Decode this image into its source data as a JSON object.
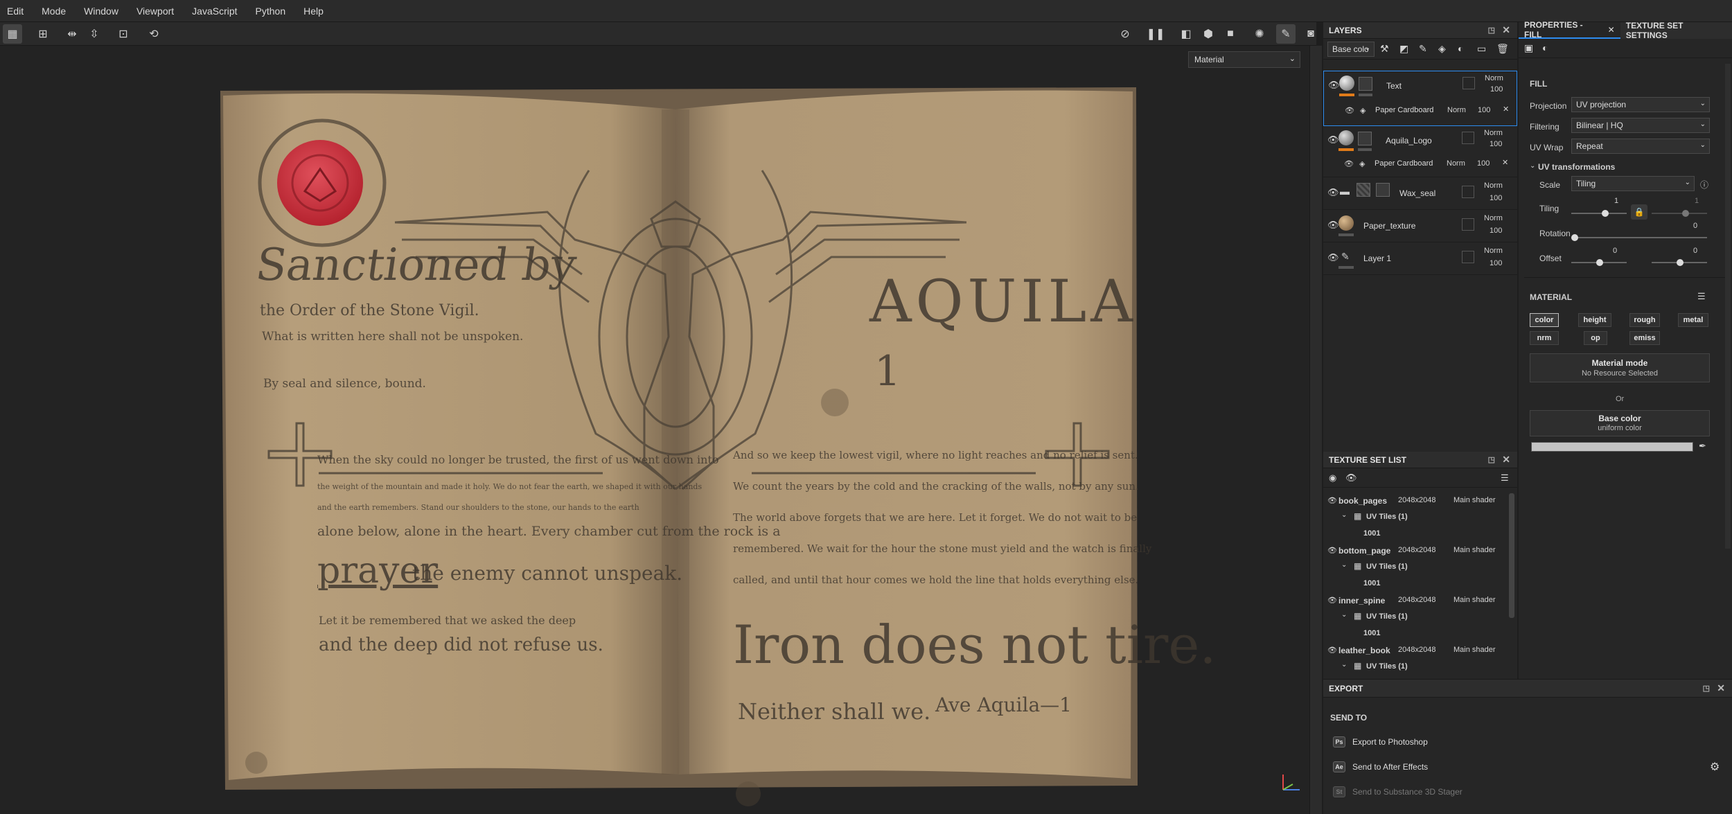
{
  "menu": [
    "Edit",
    "Mode",
    "Window",
    "Viewport",
    "JavaScript",
    "Python",
    "Help"
  ],
  "viewport": {
    "material_select": "Material"
  },
  "book": {
    "left_page": {
      "heading": "Sanctioned by",
      "line1": "the Order of the Stone Vigil.",
      "line2": "What is written here shall not be unspoken.",
      "line3": "By seal and silence, bound.",
      "para1": "When the sky could no longer be trusted, the first of us went down into",
      "para2": "the weight of the mountain and made it holy. We do not fear the earth, we shaped it with our hands",
      "para3": "and the earth remembers. Stand our shoulders to the stone, our hands to the earth",
      "para4": "alone below, alone in the heart. Every chamber cut from the rock is a",
      "prayer": "prayer",
      "prayer_rest": "the enemy cannot unspeak.",
      "remember": "Let it be remembered that we asked the deep",
      "deep": "and the deep did not refuse us."
    },
    "right_page": {
      "title": "AQUILA",
      "number": "1",
      "para1": "And so we keep the lowest vigil, where no light reaches and no relief is sent.",
      "para2": "We count the years by the cold and the cracking of the walls, not by any sun.",
      "para3": "The world above forgets that we are here. Let it forget. We do not wait to be",
      "para4": "remembered. We wait for the hour the stone must yield and the watch is finally",
      "para5": "called, and until that hour comes we hold the line that holds everything else.",
      "iron": "Iron does not tire.",
      "neither": "Neither shall we.",
      "signature": "Ave Aquila—1"
    }
  },
  "layers": {
    "title": "LAYERS",
    "channel": "Base colo",
    "items": [
      {
        "name": "Text",
        "blend": "Norm",
        "opacity": "100",
        "effect": "Paper Cardboard",
        "effect_blend": "Norm",
        "effect_opacity": "100"
      },
      {
        "name": "Aquila_Logo",
        "blend": "Norm",
        "opacity": "100",
        "effect": "Paper Cardboard",
        "effect_blend": "Norm",
        "effect_opacity": "100"
      },
      {
        "name": "Wax_seal",
        "blend": "Norm",
        "opacity": "100"
      },
      {
        "name": "Paper_texture",
        "blend": "Norm",
        "opacity": "100"
      },
      {
        "name": "Layer 1",
        "blend": "Norm",
        "opacity": "100"
      }
    ]
  },
  "texture_sets": {
    "title": "TEXTURE SET LIST",
    "items": [
      {
        "name": "book_pages",
        "res": "2048x2048",
        "shader": "Main shader",
        "uv": "UV Tiles (1)",
        "tile": "1001"
      },
      {
        "name": "bottom_page",
        "res": "2048x2048",
        "shader": "Main shader",
        "uv": "UV Tiles (1)",
        "tile": "1001"
      },
      {
        "name": "inner_spine",
        "res": "2048x2048",
        "shader": "Main shader",
        "uv": "UV Tiles (1)",
        "tile": "1001"
      },
      {
        "name": "leather_book",
        "res": "2048x2048",
        "shader": "Main shader",
        "uv": "UV Tiles (1)"
      }
    ]
  },
  "properties": {
    "tab1": "PROPERTIES - FILL",
    "tab2": "TEXTURE SET SETTINGS",
    "section": "FILL",
    "projection_label": "Projection",
    "projection": "UV projection",
    "filtering_label": "Filtering",
    "filtering": "Bilinear | HQ",
    "uvwrap_label": "UV Wrap",
    "uvwrap": "Repeat",
    "uvt": "UV transformations",
    "scale_label": "Scale",
    "scale": "Tiling",
    "tiling_label": "Tiling",
    "tiling_value": "1",
    "tiling_value2": "1",
    "rotation_label": "Rotation",
    "rotation_value": "0",
    "offset_label": "Offset",
    "offset_u": "0",
    "offset_v": "0",
    "material_title": "MATERIAL",
    "channels": [
      "color",
      "height",
      "rough",
      "metal",
      "nrm",
      "op",
      "emiss"
    ],
    "material_mode": "Material mode",
    "no_resource": "No Resource Selected",
    "or": "Or",
    "base_color": "Base color",
    "uniform": "uniform color"
  },
  "export": {
    "title": "EXPORT",
    "send_to": "SEND TO",
    "items": [
      "Export to Photoshop",
      "Send to After Effects",
      "Send to Substance 3D Stager"
    ],
    "icons": [
      "Ps",
      "Ae",
      "St"
    ]
  },
  "colors": {
    "accent": "#2d8cf0",
    "layer_bar": "#e07b1a",
    "wax": "#c8323f",
    "paper": "#b39a76"
  }
}
